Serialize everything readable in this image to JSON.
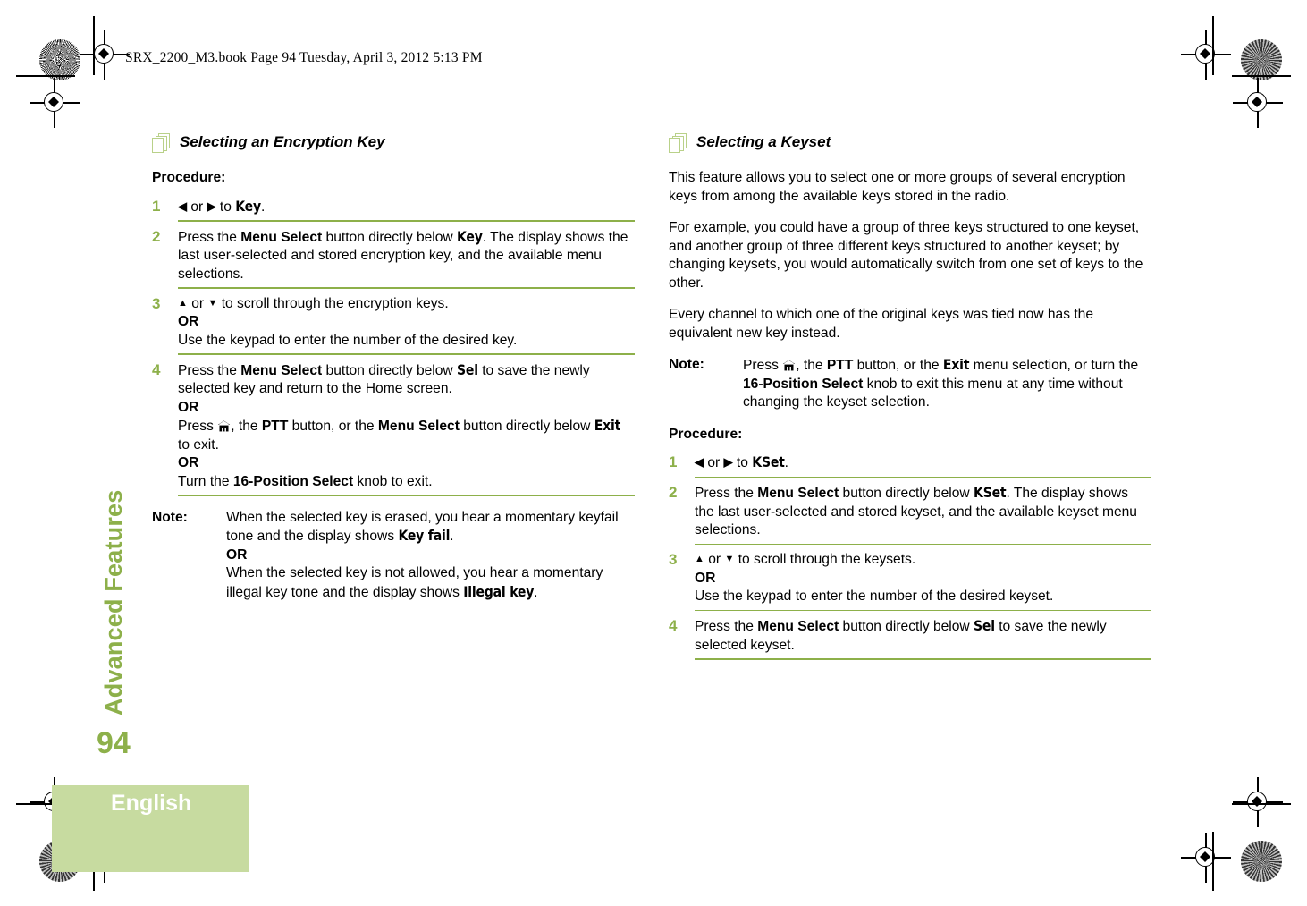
{
  "header": {
    "book_line": "SRX_2200_M3.book  Page 94  Tuesday, April 3, 2012  5:13 PM"
  },
  "sidebar": {
    "chapter_tab": "Advanced Features",
    "page_number": "94"
  },
  "footer": {
    "language": "English"
  },
  "colors": {
    "accent_green": "#8DB04A",
    "tab_green": "#C7DBA0",
    "icon_green": "#B9D189"
  },
  "icons": {
    "pages": "stacked-pages-icon",
    "home": "home-icon",
    "arrow_left": "◀",
    "arrow_right": "▶",
    "arrow_up": "▲",
    "arrow_down": "▼"
  },
  "left_column": {
    "section_title": "Selecting an Encryption Key",
    "procedure_label": "Procedure:",
    "steps": [
      {
        "num": "1",
        "id": "step-nav-to-key"
      },
      {
        "num": "2",
        "id": "step-press-menu-select-key"
      },
      {
        "num": "3",
        "id": "step-scroll-keys"
      },
      {
        "num": "4",
        "id": "step-save-key"
      }
    ],
    "step1": {
      "or": "or",
      "to": "to",
      "target": "Key",
      "period": "."
    },
    "step2": {
      "t1": "Press the ",
      "menu_select": "Menu Select",
      "t2": " button directly below ",
      "target": "Key",
      "t3": ". The display shows the last user-selected and stored encryption key, and the available menu selections."
    },
    "step3": {
      "or": "or",
      "t1": "to scroll through the encryption keys.",
      "or_label": "OR",
      "t2": "Use the keypad to enter the number of the desired key."
    },
    "step4": {
      "t1": "Press the ",
      "menu_select": "Menu Select",
      "t2": " button directly below ",
      "sel": "Sel",
      "t3": " to save the newly selected key and return to the Home screen.",
      "or_label_1": "OR",
      "t4": "Press ",
      "t5": ", the ",
      "ptt": "PTT",
      "t6": " button, or the ",
      "menu_select_2": "Menu Select",
      "t7": " button directly below ",
      "exit": "Exit",
      "t8": " to exit.",
      "or_label_2": "OR",
      "t9": "Turn the ",
      "knob": "16-Position Select",
      "t10": " knob to exit."
    },
    "note": {
      "label": "Note:",
      "t1": "When the selected key is erased, you hear a momentary keyfail tone and the display shows ",
      "disp1": "Key fail",
      "t2": ".",
      "or_label": "OR",
      "t3": "When the selected key is not allowed, you hear a momentary illegal key tone and the display shows ",
      "disp2": "Illegal key",
      "t4": "."
    }
  },
  "right_column": {
    "section_title": "Selecting a Keyset",
    "intro_1": "This feature allows you to select one or more groups of several encryption keys from among the available keys stored in the radio.",
    "intro_2": "For example, you could have a group of three keys structured to one keyset, and another group of three different keys structured to another keyset; by changing keysets, you would automatically switch from one set of keys to the other.",
    "intro_3": "Every channel to which one of the original keys was tied now has the equivalent new key instead.",
    "note": {
      "label": "Note:",
      "t1": "Press ",
      "t2": ", the ",
      "ptt": "PTT",
      "t3": " button, or the ",
      "exit": "Exit",
      "t4": " menu selection, or turn the ",
      "knob": "16-Position Select",
      "t5": " knob to exit this menu at any time without changing the keyset selection."
    },
    "procedure_label": "Procedure:",
    "steps": [
      {
        "num": "1",
        "id": "step-nav-to-kset"
      },
      {
        "num": "2",
        "id": "step-press-menu-select-kset"
      },
      {
        "num": "3",
        "id": "step-scroll-keysets"
      },
      {
        "num": "4",
        "id": "step-save-keyset"
      }
    ],
    "step1": {
      "or": "or",
      "to": "to",
      "target": "KSet",
      "period": "."
    },
    "step2": {
      "t1": "Press the ",
      "menu_select": "Menu Select",
      "t2": " button directly below ",
      "target": "KSet",
      "t3": ". The display shows the last user-selected and stored keyset, and the available keyset menu selections."
    },
    "step3": {
      "or": "or",
      "t1": "to scroll through the keysets.",
      "or_label": "OR",
      "t2": "Use the keypad to enter the number of the desired keyset."
    },
    "step4": {
      "t1": "Press the ",
      "menu_select": "Menu Select",
      "t2": " button directly below ",
      "sel": "Sel",
      "t3": " to save the newly selected keyset."
    }
  }
}
